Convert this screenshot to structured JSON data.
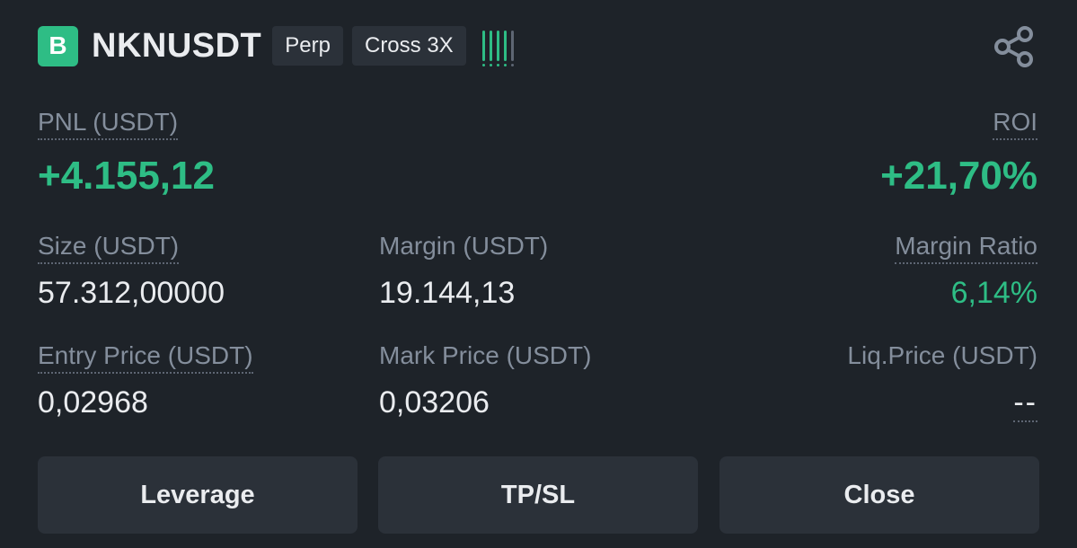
{
  "position": {
    "side_badge": "B",
    "symbol": "NKNUSDT",
    "contract_type": "Perp",
    "margin_mode": "Cross 3X",
    "adl_level": {
      "active": 4,
      "total": 5
    },
    "colors": {
      "profit": "#2ebd85",
      "background": "#1e2329",
      "panel": "#2b3139"
    }
  },
  "header": {
    "share_icon": "share-icon"
  },
  "pnl": {
    "label": "PNL (USDT)",
    "value": "+4.155,12"
  },
  "roi": {
    "label": "ROI",
    "value": "+21,70%"
  },
  "size": {
    "label": "Size (USDT)",
    "value": "57.312,00000"
  },
  "margin": {
    "label": "Margin (USDT)",
    "value": "19.144,13"
  },
  "margin_ratio": {
    "label": "Margin Ratio",
    "value": "6,14%"
  },
  "entry_price": {
    "label": "Entry Price (USDT)",
    "value": "0,02968"
  },
  "mark_price": {
    "label": "Mark Price (USDT)",
    "value": "0,03206"
  },
  "liq_price": {
    "label": "Liq.Price (USDT)",
    "value": "--"
  },
  "actions": {
    "leverage": "Leverage",
    "tpsl": "TP/SL",
    "close": "Close"
  }
}
